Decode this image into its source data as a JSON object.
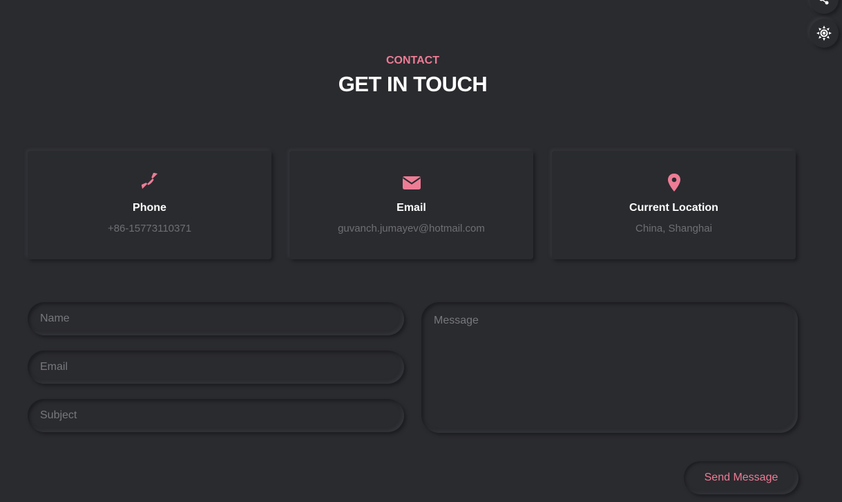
{
  "colors": {
    "background": "#2a2b2f",
    "accent": "#ee7c95",
    "heading": "#ffffff",
    "muted_text": "#6e6f74",
    "placeholder_text": "#77787d"
  },
  "floating_controls": {
    "share_icon": "share-icon",
    "theme_icon": "sun-icon"
  },
  "header": {
    "eyebrow": "CONTACT",
    "title": "GET IN TOUCH"
  },
  "cards": [
    {
      "icon": "phone-icon",
      "label": "Phone",
      "value": "+86-15773110371"
    },
    {
      "icon": "envelope-icon",
      "label": "Email",
      "value": "guvanch.jumayev@hotmail.com"
    },
    {
      "icon": "map-pin-icon",
      "label": "Current Location",
      "value": "China, Shanghai"
    }
  ],
  "form": {
    "name_placeholder": "Name",
    "email_placeholder": "Email",
    "subject_placeholder": "Subject",
    "message_placeholder": "Message",
    "name_value": "",
    "email_value": "",
    "subject_value": "",
    "message_value": "",
    "send_label": "Send Message"
  }
}
